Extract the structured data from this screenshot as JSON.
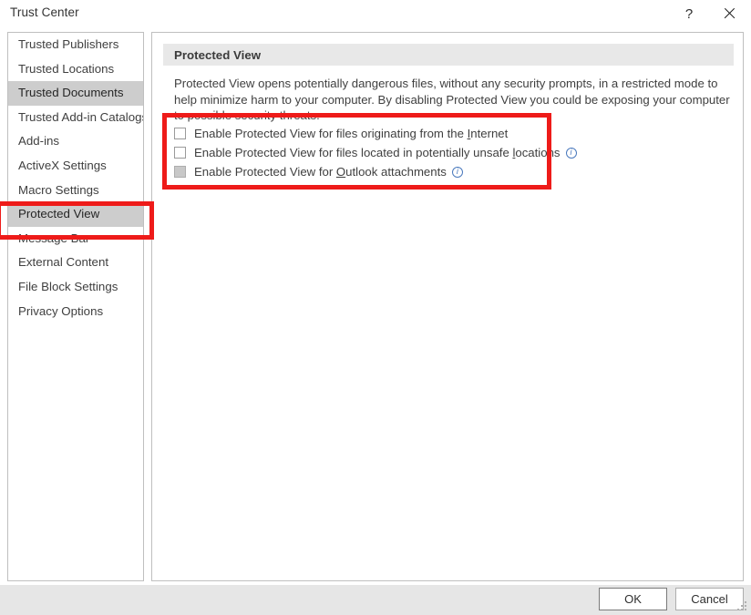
{
  "window": {
    "title": "Trust Center",
    "help_label": "?",
    "close_label": "close-icon"
  },
  "sidebar": {
    "items": [
      {
        "label": "Trusted Publishers",
        "selected": false
      },
      {
        "label": "Trusted Locations",
        "selected": false
      },
      {
        "label": "Trusted Documents",
        "selected": true
      },
      {
        "label": "Trusted Add-in Catalogs",
        "selected": false
      },
      {
        "label": "Add-ins",
        "selected": false
      },
      {
        "label": "ActiveX Settings",
        "selected": false
      },
      {
        "label": "Macro Settings",
        "selected": false
      },
      {
        "label": "Protected View",
        "selected": true
      },
      {
        "label": "Message Bar",
        "selected": false
      },
      {
        "label": "External Content",
        "selected": false
      },
      {
        "label": "File Block Settings",
        "selected": false
      },
      {
        "label": "Privacy Options",
        "selected": false
      }
    ]
  },
  "content": {
    "section_title": "Protected View",
    "description": "Protected View opens potentially dangerous files, without any security prompts, in a restricted mode to help minimize harm to your computer. By disabling Protected View you could be exposing your computer to possible security threats.",
    "checkboxes": [
      {
        "label_before": "Enable Protected View for files originating from the ",
        "accel": "I",
        "label_after": "nternet",
        "checked": false,
        "disabled": false,
        "info": false
      },
      {
        "label_before": "Enable Protected View for files located in potentially unsafe ",
        "accel": "l",
        "label_after": "ocations",
        "checked": false,
        "disabled": false,
        "info": true
      },
      {
        "label_before": "Enable Protected View for ",
        "accel": "O",
        "label_after": "utlook attachments",
        "checked": false,
        "disabled": true,
        "info": true
      }
    ],
    "info_icon_glyph": "i"
  },
  "footer": {
    "ok_label": "OK",
    "cancel_label": "Cancel"
  },
  "annotations": {
    "highlight_color": "#ee1b19",
    "sidebar_target": "Protected View",
    "checkbox_group_target": "Protected View checkbox group"
  }
}
